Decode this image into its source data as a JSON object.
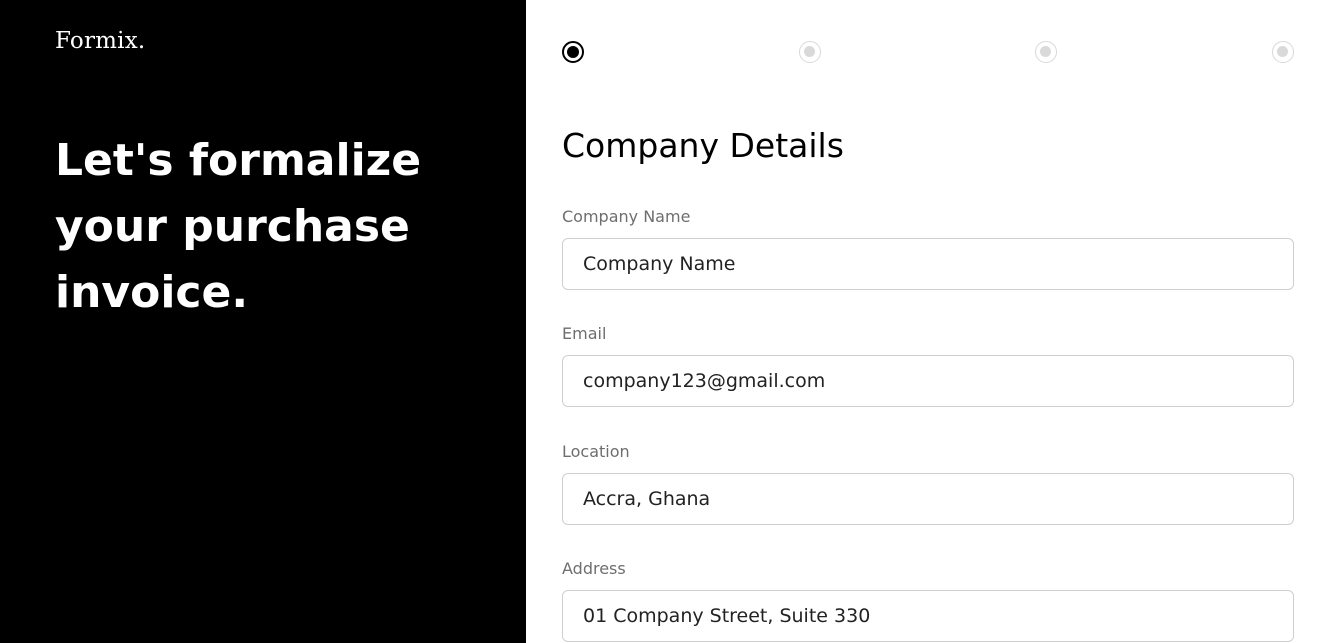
{
  "brand": {
    "logo_text": "Formix."
  },
  "hero": {
    "headline": "Let's formalize your purchase invoice."
  },
  "stepper": {
    "total_steps": 4,
    "current_step": 1
  },
  "form": {
    "title": "Company Details",
    "fields": [
      {
        "label": "Company Name",
        "value": "Company Name"
      },
      {
        "label": "Email",
        "value": "company123@gmail.com"
      },
      {
        "label": "Location",
        "value": "Accra, Ghana"
      },
      {
        "label": "Address",
        "value": "01 Company Street, Suite 330"
      }
    ]
  },
  "colors": {
    "left_panel_bg": "#000000",
    "accent": "#000000",
    "inactive_step": "#d9d9d9",
    "label_text": "#6e6e6e",
    "input_border": "#cfcfcf"
  }
}
